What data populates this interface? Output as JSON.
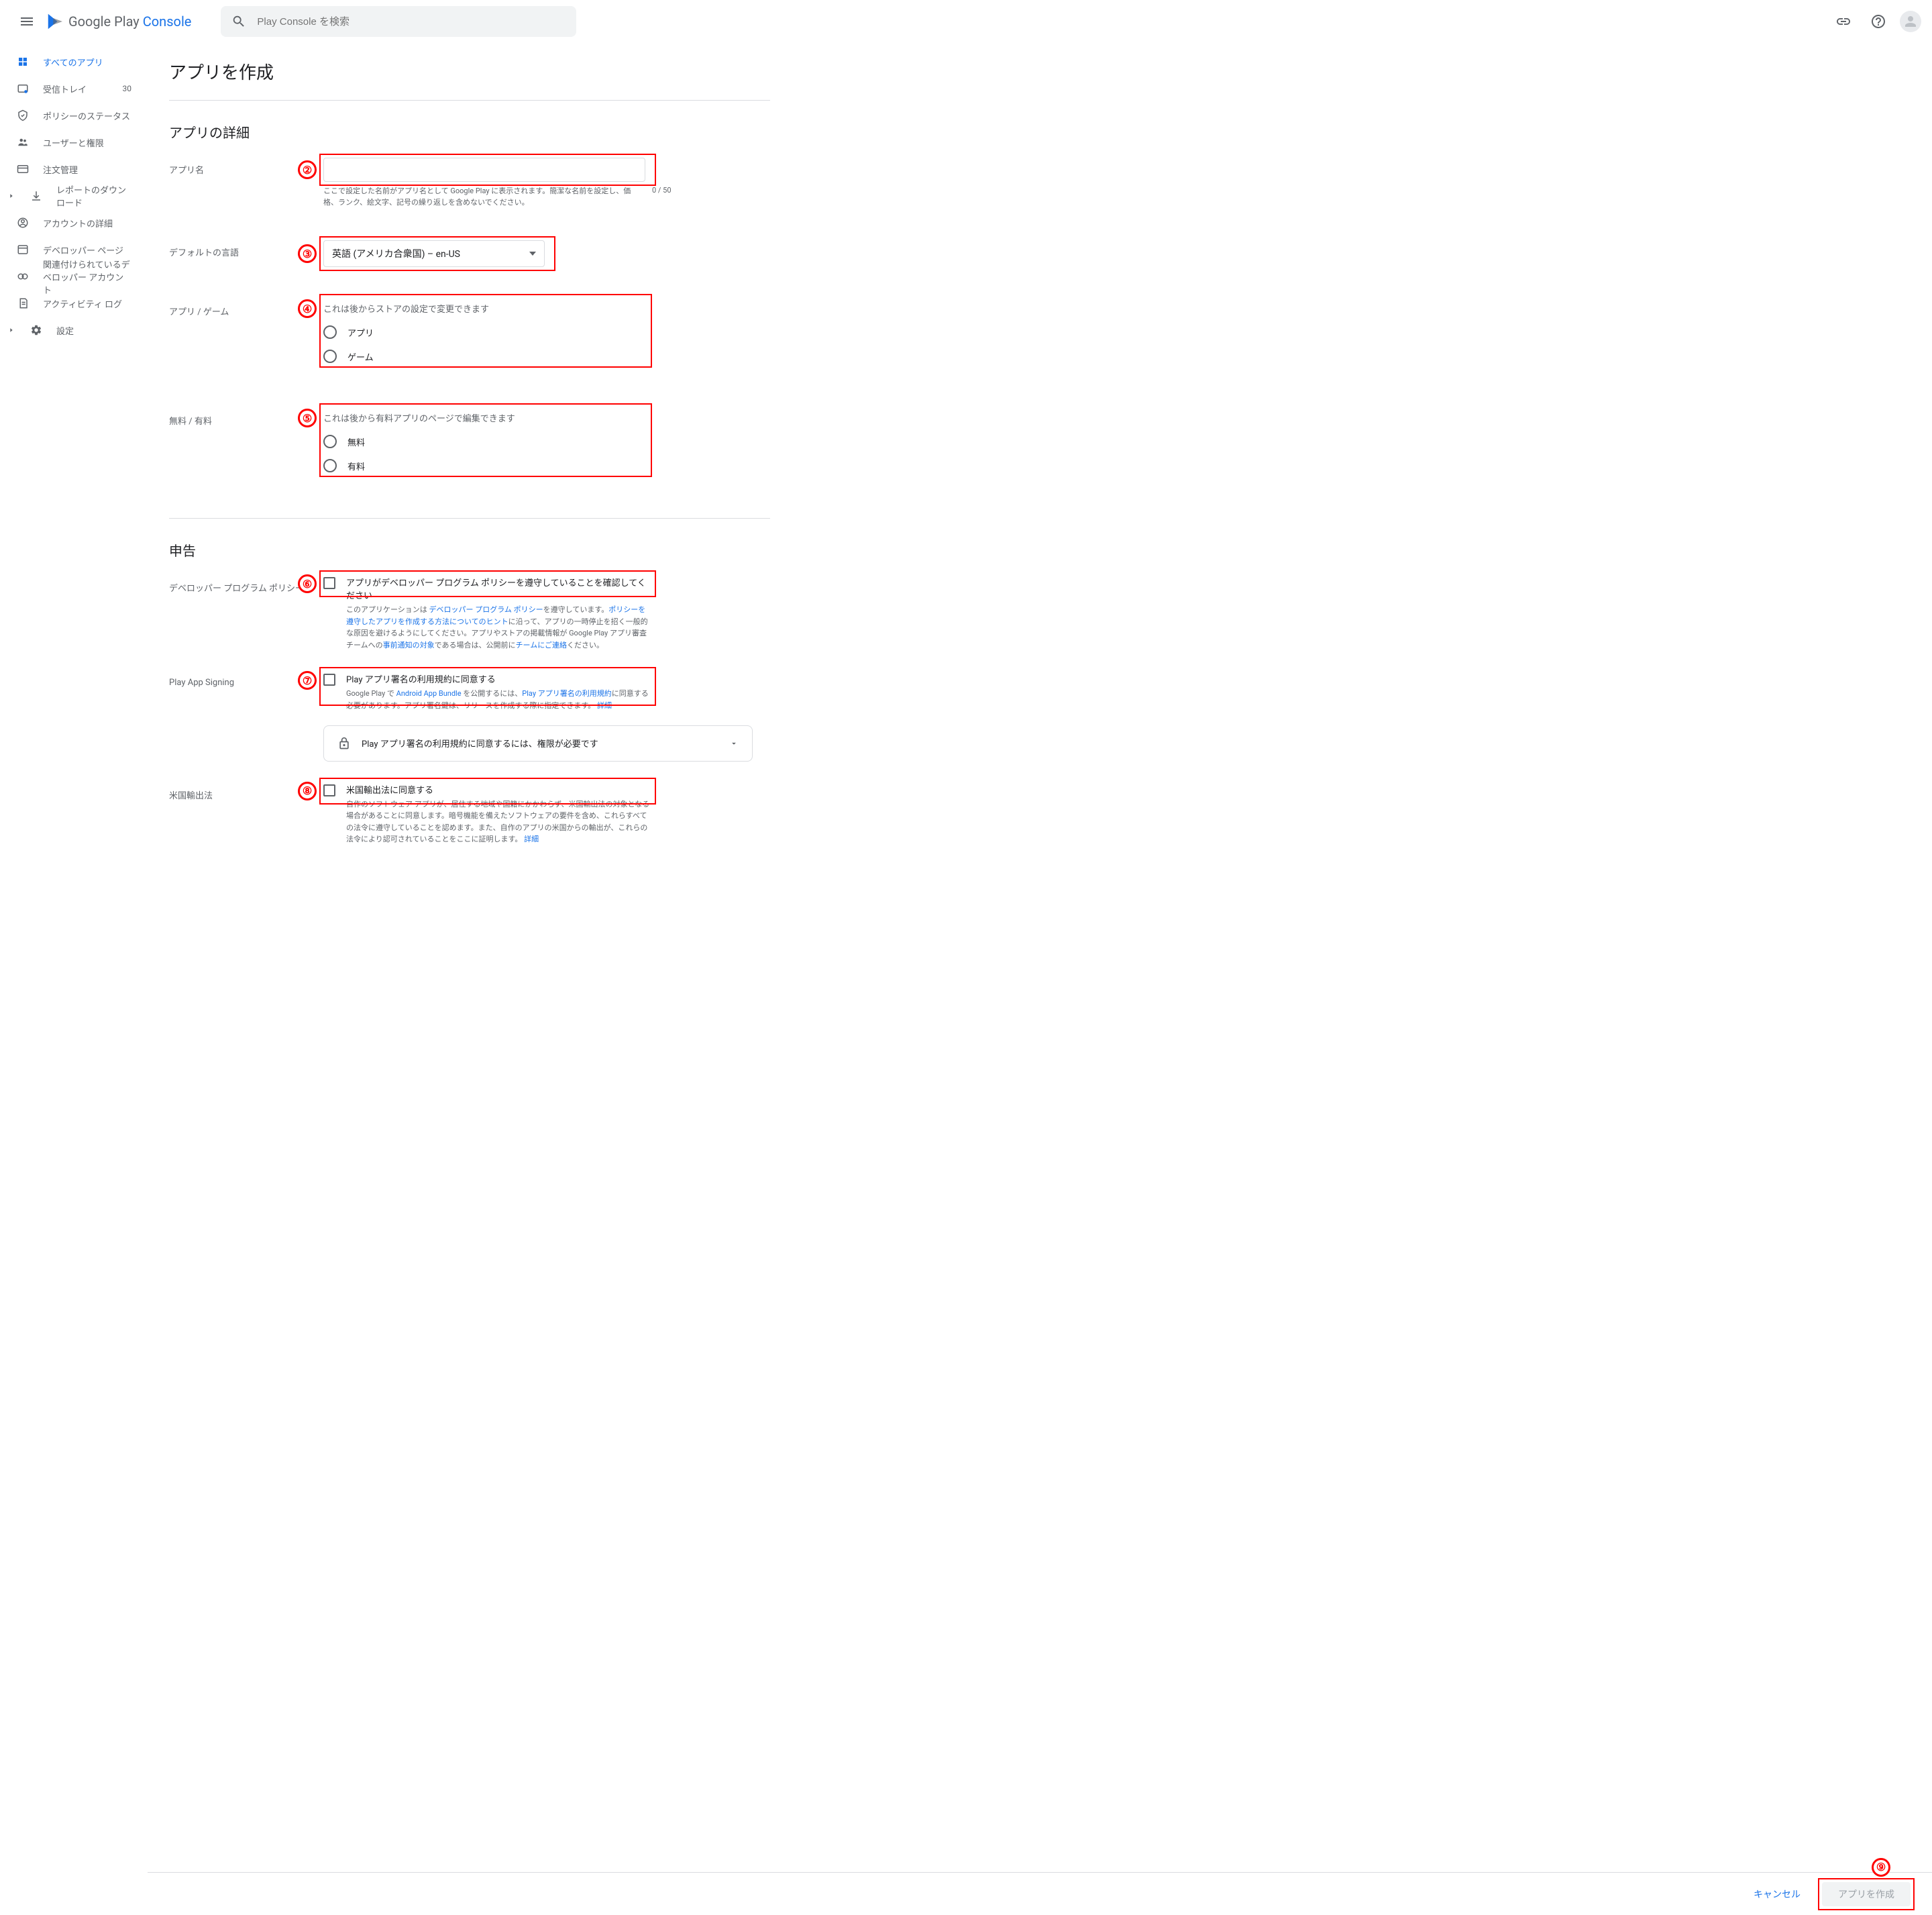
{
  "header": {
    "brand_google_play": "Google Play",
    "brand_console": "Console",
    "search_placeholder": "Play Console を検索"
  },
  "sidebar": {
    "items": [
      {
        "label": "すべてのアプリ"
      },
      {
        "label": "受信トレイ",
        "badge": "30"
      },
      {
        "label": "ポリシーのステータス"
      },
      {
        "label": "ユーザーと権限"
      },
      {
        "label": "注文管理"
      },
      {
        "label": "レポートのダウンロード"
      },
      {
        "label": "アカウントの詳細"
      },
      {
        "label": "デベロッパー ページ"
      },
      {
        "label": "関連付けられているデベロッパー アカウント"
      },
      {
        "label": "アクティビティ ログ"
      },
      {
        "label": "設定"
      }
    ]
  },
  "page": {
    "title": "アプリを作成",
    "section_details": "アプリの詳細",
    "section_declarations": "申告"
  },
  "form": {
    "app_name": {
      "label": "アプリ名",
      "helper": "ここで設定した名前がアプリ名として Google Play に表示されます。簡潔な名前を設定し、価格、ランク、絵文字、記号の繰り返しを含めないでください。",
      "count": "0 / 50"
    },
    "default_lang": {
      "label": "デフォルトの言語",
      "value": "英語 (アメリカ合衆国) – en-US"
    },
    "app_game": {
      "label": "アプリ / ゲーム",
      "hint": "これは後からストアの設定で変更できます",
      "opt_app": "アプリ",
      "opt_game": "ゲーム"
    },
    "free_paid": {
      "label": "無料 / 有料",
      "hint": "これは後から有料アプリのページで編集できます",
      "opt_free": "無料",
      "opt_paid": "有料"
    },
    "dev_policy": {
      "label": "デベロッパー プログラム ポリシー",
      "checkbox_label": "アプリがデベロッパー プログラム ポリシーを遵守していることを確認してください",
      "desc_p1": "このアプリケーションは",
      "desc_link1": "デベロッパー プログラム ポリシー",
      "desc_p2": "を遵守しています。",
      "desc_link2": "ポリシーを遵守したアプリを作成する方法についてのヒント",
      "desc_p3": "に沿って、アプリの一時停止を招く一般的な原因を避けるようにしてください。アプリやストアの掲載情報が Google Play アプリ審査チームへの",
      "desc_link3": "事前通知の対象",
      "desc_p4": "である場合は、公開前に",
      "desc_link4": "チームにご連絡",
      "desc_p5": "ください。"
    },
    "app_signing": {
      "label": "Play App Signing",
      "checkbox_label": "Play アプリ署名の利用規約に同意する",
      "desc_p1": "Google Play で ",
      "desc_link1": "Android App Bundle",
      "desc_p2": " を公開するには、",
      "desc_link2": "Play アプリ署名の利用規約",
      "desc_p3": "に同意する必要があります。アプリ署名鍵は、リリースを作成する際に指定できます。 ",
      "desc_link3": "詳細",
      "expand_text": "Play アプリ署名の利用規約に同意するには、権限が必要です"
    },
    "us_export": {
      "label": "米国輸出法",
      "checkbox_label": "米国輸出法に同意する",
      "desc_p1": "自作のソフトウェア アプリが、居住する地域や国籍にかかわらず、米国輸出法の対象となる場合があることに同意します。暗号機能を備えたソフトウェアの要件を含め、これらすべての法令に遵守していることを認めます。また、自作のアプリの米国からの輸出が、これらの法令により認可されていることをここに証明します。 ",
      "desc_link1": "詳細"
    }
  },
  "footer": {
    "cancel": "キャンセル",
    "create": "アプリを作成"
  },
  "badges": {
    "b2": "②",
    "b3": "③",
    "b4": "④",
    "b5": "⑤",
    "b6": "⑥",
    "b7": "⑦",
    "b8": "⑧",
    "b9": "⑨"
  }
}
